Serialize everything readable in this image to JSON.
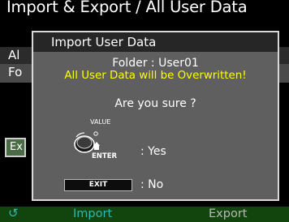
{
  "screen": {
    "title": "Import & Export / All User Data",
    "list": [
      "Al",
      "Fo"
    ],
    "exec_button": "Ex"
  },
  "dialog": {
    "title": "Import User Data",
    "folder_line": "Folder : User01",
    "warning": "All User Data will be Overwritten!",
    "question": "Are you sure ?",
    "knob_label": "VALUE",
    "enter_label": "ENTER",
    "yes_label": ": Yes",
    "exit_key_label": "EXIT",
    "no_label": ": No"
  },
  "footer": {
    "icon": "refresh-icon",
    "import_label": "Import",
    "export_label": "Export"
  },
  "colors": {
    "warning": "#ffff00",
    "footer_bg": "#12450e",
    "footer_active": "#2fb7b0"
  }
}
